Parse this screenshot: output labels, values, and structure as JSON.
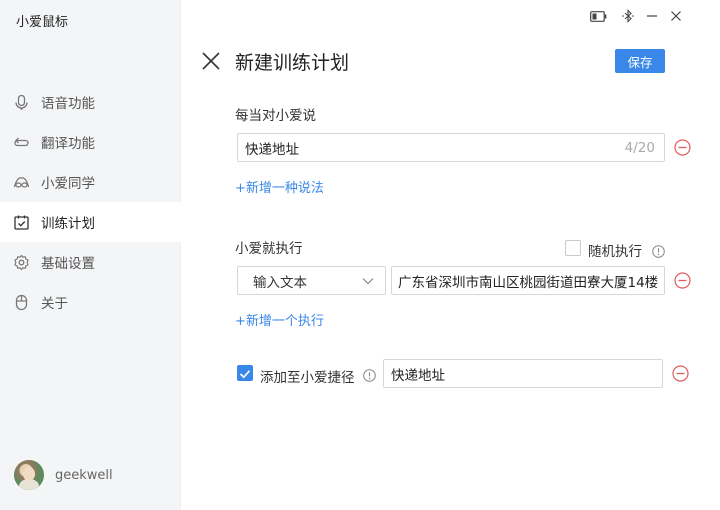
{
  "app": {
    "title": "小爱鼠标"
  },
  "window_controls": {
    "icons": [
      "battery-icon",
      "bluetooth-icon",
      "minimize-icon",
      "close-icon"
    ]
  },
  "sidebar": {
    "items": [
      {
        "label": "语音功能",
        "icon": "microphone-icon",
        "active": false
      },
      {
        "label": "翻译功能",
        "icon": "translate-loop-icon",
        "active": false
      },
      {
        "label": "小爱同学",
        "icon": "xiaoai-icon",
        "active": false
      },
      {
        "label": "训练计划",
        "icon": "calendar-check-icon",
        "active": true
      },
      {
        "label": "基础设置",
        "icon": "gear-icon",
        "active": false
      },
      {
        "label": "关于",
        "icon": "mouse-icon",
        "active": false
      }
    ],
    "user": {
      "name": "geekwell"
    }
  },
  "header": {
    "title": "新建训练计划",
    "save_label": "保存"
  },
  "trigger": {
    "label": "每当对小爱说",
    "phrase": "快递地址",
    "counter": "4/20",
    "add_link": "+新增一种说法"
  },
  "action": {
    "label": "小爱就执行",
    "random_label": "随机执行",
    "random_checked": false,
    "type_selected": "输入文本",
    "text_value": "广东省深圳市南山区桃园街道田寮大厦14楼",
    "add_link": "+新增一个执行"
  },
  "shortcut": {
    "checked": true,
    "label": "添加至小爱捷径",
    "value": "快递地址"
  },
  "colors": {
    "accent": "#3a87ea",
    "danger": "#e05a5a",
    "sidebar_bg": "#f4f5f7"
  }
}
